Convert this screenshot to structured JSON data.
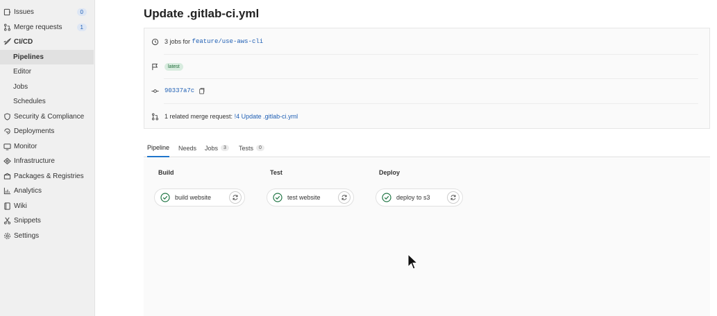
{
  "sidebar": {
    "items": [
      {
        "label": "Issues",
        "count": "0",
        "icon": "issues-icon"
      },
      {
        "label": "Merge requests",
        "count": "1",
        "icon": "merge-request-icon"
      },
      {
        "label": "CI/CD",
        "icon": "rocket-icon"
      },
      {
        "label": "Security & Compliance",
        "icon": "shield-icon"
      },
      {
        "label": "Deployments",
        "icon": "deployments-icon"
      },
      {
        "label": "Monitor",
        "icon": "monitor-icon"
      },
      {
        "label": "Infrastructure",
        "icon": "cloud-icon"
      },
      {
        "label": "Packages & Registries",
        "icon": "package-icon"
      },
      {
        "label": "Analytics",
        "icon": "chart-icon"
      },
      {
        "label": "Wiki",
        "icon": "book-icon"
      },
      {
        "label": "Snippets",
        "icon": "scissors-icon"
      },
      {
        "label": "Settings",
        "icon": "gear-icon"
      }
    ],
    "cicd_sub": [
      "Pipelines",
      "Editor",
      "Jobs",
      "Schedules"
    ]
  },
  "page": {
    "title": "Update .gitlab-ci.yml",
    "jobs_text": "3 jobs for",
    "branch": "feature/use-aws-cli",
    "tag": "latest",
    "commit": "90337a7c",
    "related_text": "1 related merge request:",
    "related_link": "!4 Update .gitlab-ci.yml"
  },
  "tabs": [
    {
      "label": "Pipeline"
    },
    {
      "label": "Needs"
    },
    {
      "label": "Jobs",
      "count": "3"
    },
    {
      "label": "Tests",
      "count": "0"
    }
  ],
  "stages": [
    {
      "title": "Build",
      "job": "build website"
    },
    {
      "title": "Test",
      "job": "test website"
    },
    {
      "title": "Deploy",
      "job": "deploy to s3"
    }
  ],
  "colors": {
    "success": "#217645",
    "link": "#1f5fb4",
    "active_tab": "#1f75cb"
  }
}
